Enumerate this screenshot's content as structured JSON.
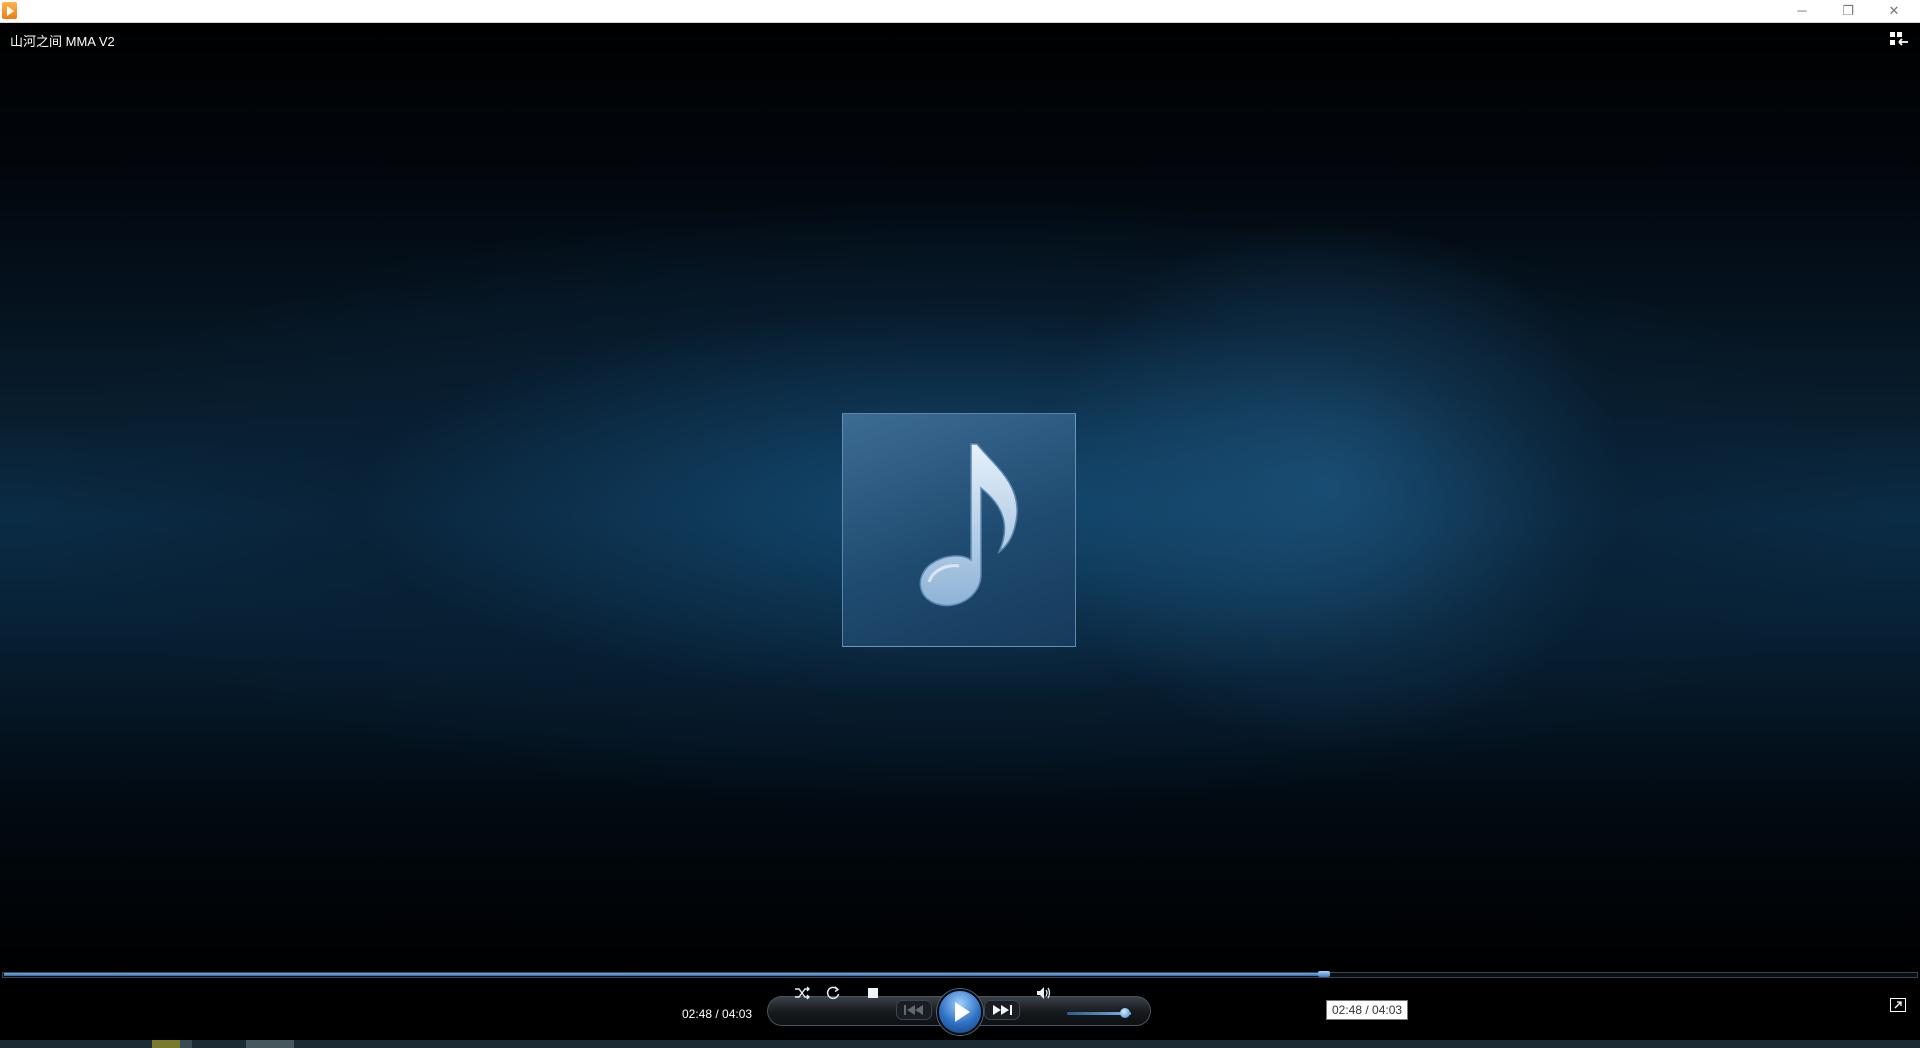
{
  "window": {
    "minimize_symbol": "─",
    "maximize_symbol": "❐",
    "close_symbol": "✕"
  },
  "now_playing": {
    "title": "山河之间 MMA V2"
  },
  "playback": {
    "elapsed": "02:48",
    "duration": "04:03",
    "time_display": "02:48 / 04:03",
    "progress_fraction": 0.691,
    "volume_fraction": 0.9,
    "state": "paused"
  },
  "tooltip": {
    "text": "02:48 / 04:03"
  },
  "icons": {
    "app": "media-player-icon",
    "library": "switch-to-library-icon",
    "shuffle": "shuffle-icon",
    "repeat": "repeat-icon",
    "stop": "stop-icon",
    "previous": "previous-icon",
    "play": "play-icon",
    "next": "next-icon",
    "volume": "speaker-icon",
    "fullscreen": "fullscreen-icon",
    "album_art": "music-note-icon"
  },
  "colors": {
    "accent": "#2f72c4",
    "background": "#000000"
  }
}
